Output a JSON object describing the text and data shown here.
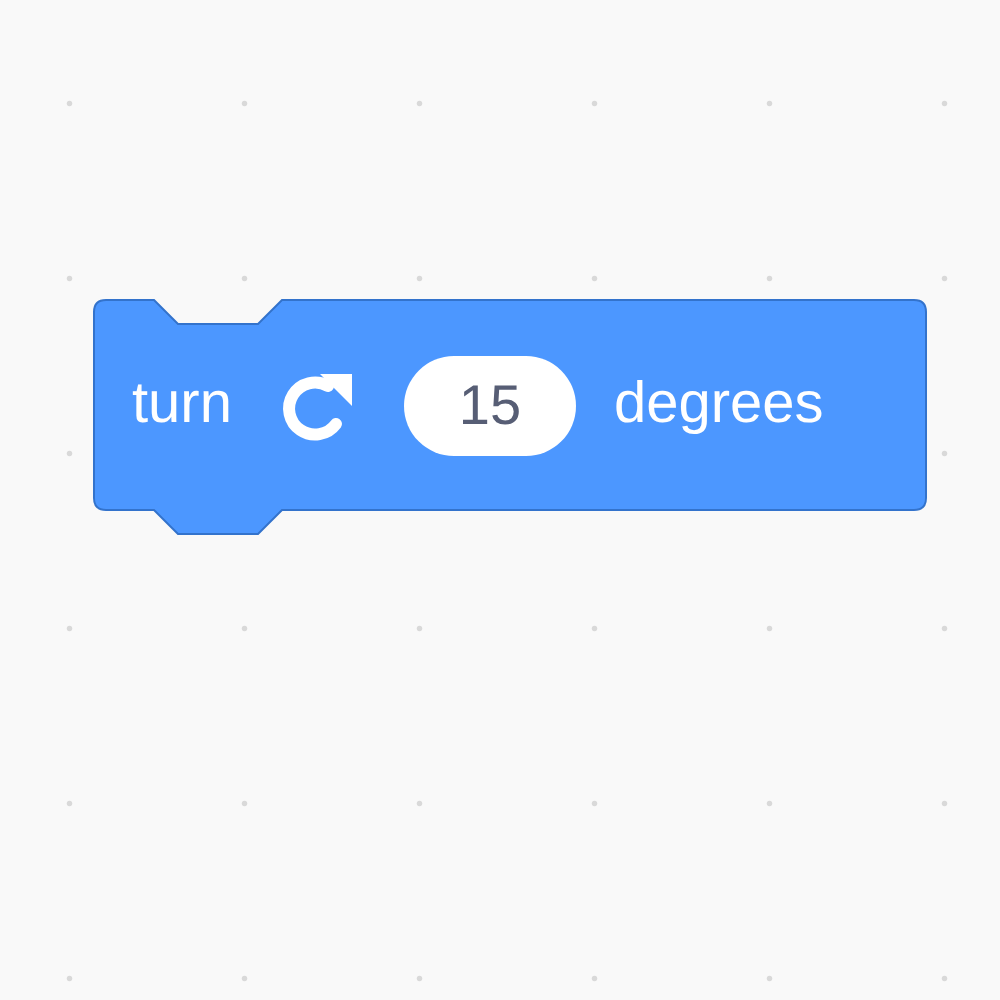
{
  "block": {
    "kind": "motion",
    "label": "turn",
    "field": {
      "value": "15"
    },
    "suffix": "degrees"
  }
}
